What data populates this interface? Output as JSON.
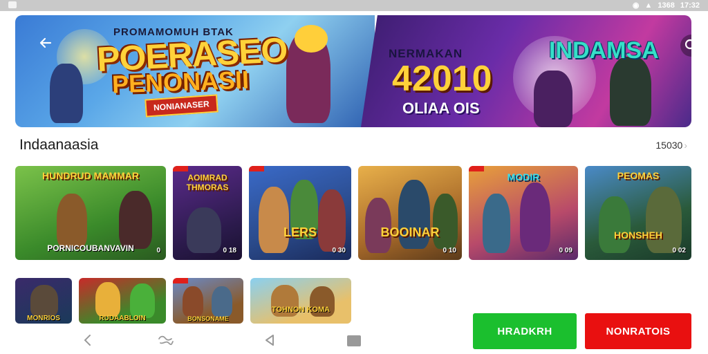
{
  "status_bar": {
    "time": "17:32",
    "battery": "1368"
  },
  "banner": {
    "subtitle": "PROMAMOMUH BTAK",
    "title_line1": "POERASEO",
    "title_line2": "PENONASII",
    "tag": "NONIANASER",
    "right_subtitle": "NERMAKAN",
    "right_number": "42010",
    "right_caption": "OLIAA OIS",
    "right_title": "INDAMSA"
  },
  "section": {
    "title": "Indaanaasia",
    "count": "15030"
  },
  "games_row1": [
    {
      "top": "HUNDRUD MAMMAR",
      "label": "PORNICOUBANVAVIN",
      "badge": "0"
    },
    {
      "top": "AOIMRAD THMORAS",
      "label": "",
      "badge": "0 18"
    },
    {
      "top": "",
      "label": "LERS",
      "badge": "0 30"
    },
    {
      "top": "",
      "label": "BOOINAR",
      "badge": "0 10"
    },
    {
      "top": "MODIR",
      "label": "",
      "badge": "0 09"
    },
    {
      "top": "PEOMAS",
      "label": "HONSHEH",
      "badge": "0 02"
    }
  ],
  "games_row2": [
    {
      "label": "MONRIOS"
    },
    {
      "label": "RUDAABLOIN"
    },
    {
      "label": "BONSONAME"
    },
    {
      "label": "TOHNON KOMA"
    }
  ],
  "buttons": {
    "primary": "HRADKRH",
    "secondary": "NONRATOIS"
  },
  "colors": {
    "primary": "#1bbf2e",
    "secondary": "#e91010",
    "accent": "#ffd23a"
  }
}
